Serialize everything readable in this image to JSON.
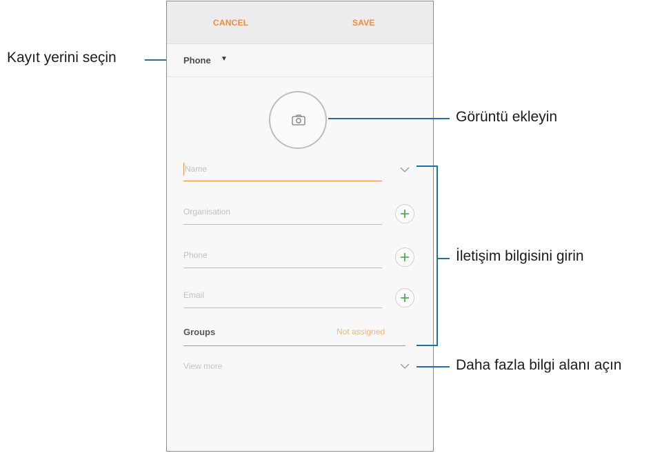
{
  "topbar": {
    "cancel_label": "CANCEL",
    "save_label": "SAVE"
  },
  "storage": {
    "selected": "Phone",
    "arrow": "▼"
  },
  "photo": {
    "icon": "camera-icon"
  },
  "fields": {
    "name": "Name",
    "organisation": "Organisation",
    "phone": "Phone",
    "email": "Email"
  },
  "groups": {
    "label": "Groups",
    "value": "Not assigned"
  },
  "view_more": "View more",
  "annotations": {
    "storage": "Kayıt yerini seçin",
    "image": "Görüntü ekleyin",
    "contact_info": "İletişim bilgisini girin",
    "more_fields": "Daha fazla bilgi alanı açın"
  },
  "colors": {
    "accent": "#f08a3c",
    "plus": "#4caf50",
    "annotation_line": "#1e6fa8"
  }
}
